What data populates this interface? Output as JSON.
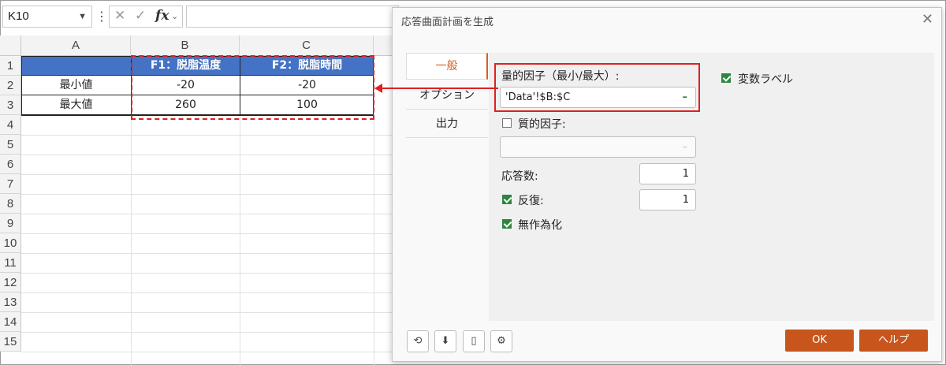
{
  "namebox": {
    "value": "K10"
  },
  "formula_bar": {
    "fx_label": "fx",
    "value": ""
  },
  "columns": [
    "A",
    "B",
    "C"
  ],
  "rows": [
    "1",
    "2",
    "3",
    "4",
    "5",
    "6",
    "7",
    "8",
    "9",
    "10",
    "11",
    "12",
    "13",
    "14",
    "15"
  ],
  "table": {
    "headers": [
      "",
      "F1：脱脂温度",
      "F2：脱脂時間"
    ],
    "rows": [
      [
        "最小値",
        "-20",
        "-20"
      ],
      [
        "最大値",
        "260",
        "100"
      ]
    ]
  },
  "dialog": {
    "title": "応答曲面計画を生成",
    "tabs": [
      "一般",
      "オプション",
      "出力"
    ],
    "quantitative_label": "量的因子（最小/最大）:",
    "quantitative_value": "'Data'!$B:$C",
    "variable_labels": "変数ラベル",
    "qualitative_label": "質的因子:",
    "qualitative_value": "",
    "responses_label": "応答数:",
    "responses_value": "1",
    "replicates_label": "反復:",
    "replicates_value": "1",
    "randomize_label": "無作為化",
    "ok": "OK",
    "help": "ヘルプ",
    "dash": "–"
  },
  "colors": {
    "accent": "#d65f1e",
    "header_fill": "#4472c4",
    "highlight": "#e02020",
    "check": "#2e8540"
  }
}
